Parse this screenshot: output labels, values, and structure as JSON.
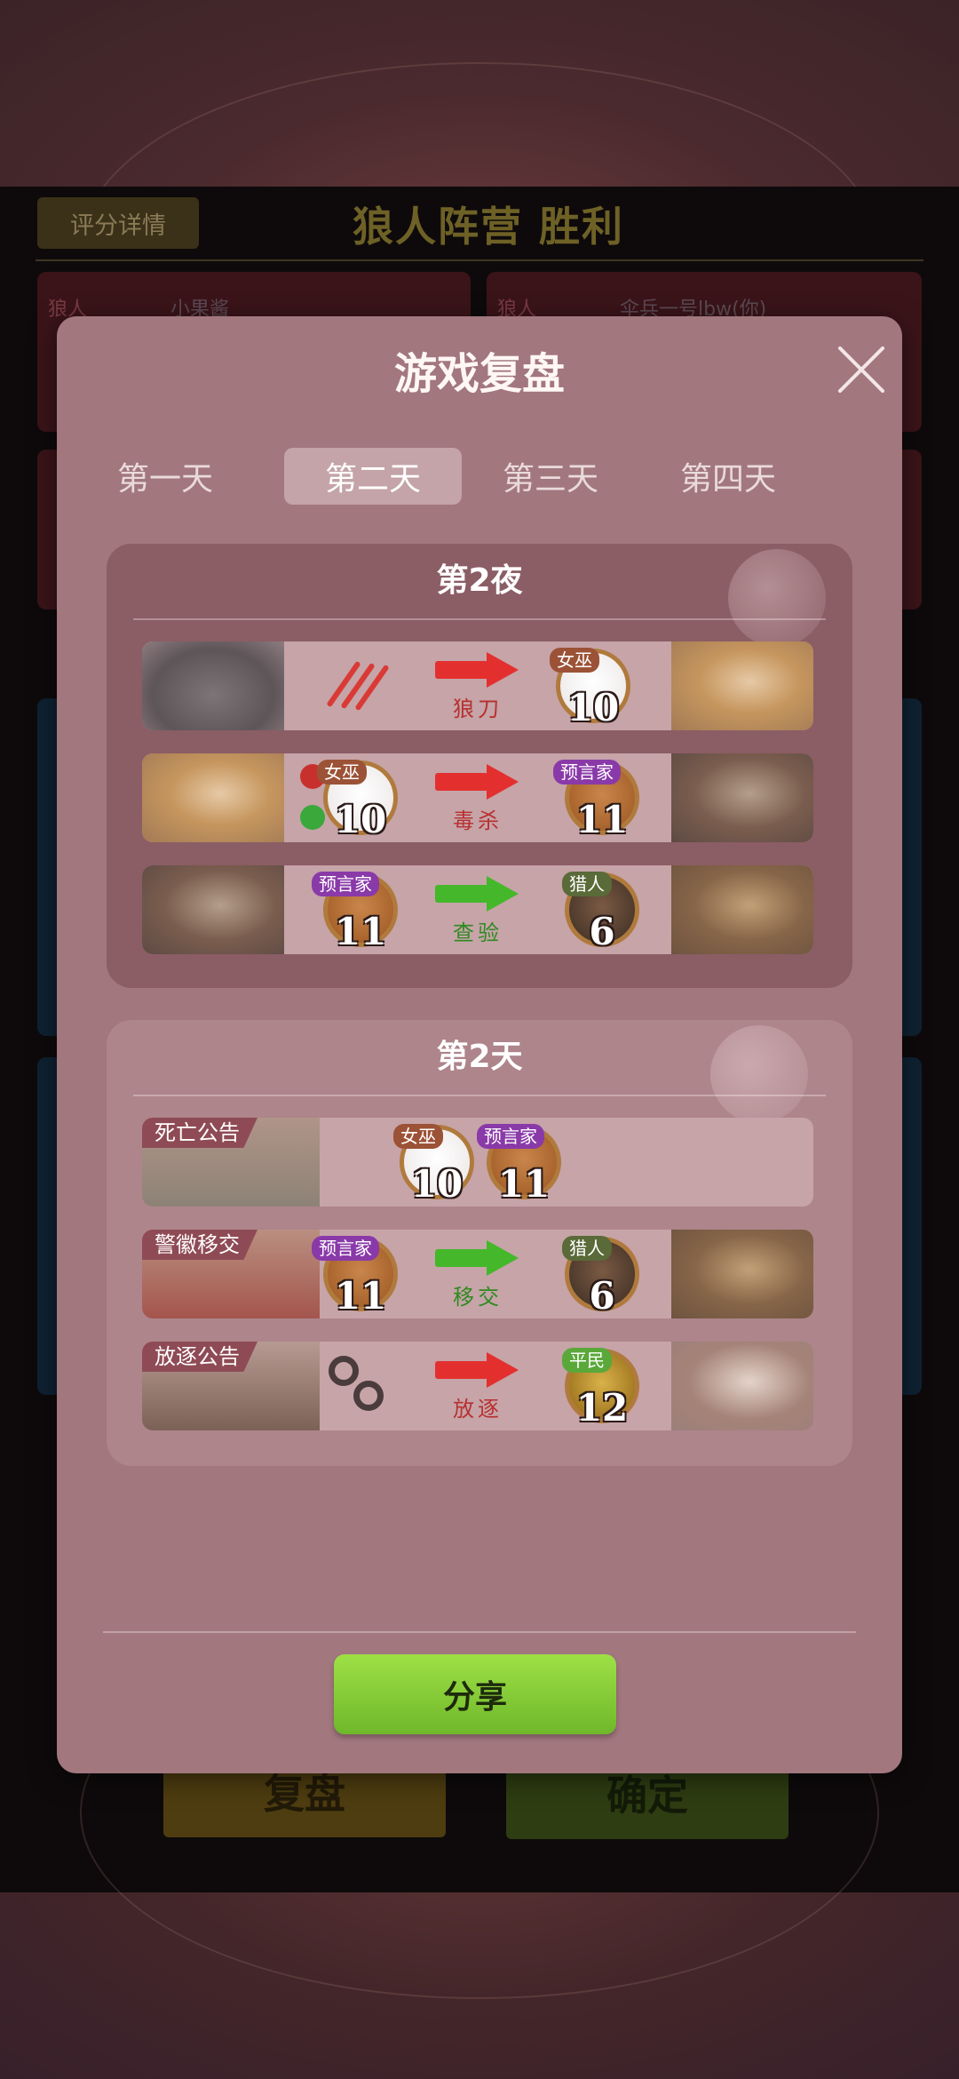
{
  "background": {
    "score_detail_label": "评分详情",
    "result_title": "狼人阵营  胜利",
    "cards": [
      {
        "label": "狼人",
        "name": "小果酱"
      },
      {
        "label": "狼人",
        "name": "伞兵一号lbw(你)"
      }
    ],
    "replay_button": "复盘",
    "confirm_button": "确定"
  },
  "modal": {
    "title": "游戏复盘",
    "tabs": [
      {
        "label": "第一天",
        "active": false
      },
      {
        "label": "第二天",
        "active": true
      },
      {
        "label": "第三天",
        "active": false
      },
      {
        "label": "第四天",
        "active": false
      }
    ],
    "night": {
      "title": "第2夜",
      "rows": [
        {
          "actor_role": "",
          "actor_number": "",
          "action": "狼刀",
          "color": "red",
          "target_role": "女巫",
          "target_number": "10"
        },
        {
          "actor_role": "女巫",
          "actor_number": "10",
          "action": "毒杀",
          "color": "red",
          "target_role": "预言家",
          "target_number": "11"
        },
        {
          "actor_role": "预言家",
          "actor_number": "11",
          "action": "查验",
          "color": "green",
          "target_role": "猎人",
          "target_number": "6"
        }
      ]
    },
    "day": {
      "title": "第2天",
      "rows": [
        {
          "event": "死亡公告",
          "players": [
            {
              "role": "女巫",
              "number": "10"
            },
            {
              "role": "预言家",
              "number": "11"
            }
          ]
        },
        {
          "event": "警徽移交",
          "actor_role": "预言家",
          "actor_number": "11",
          "action": "移交",
          "color": "green",
          "target_role": "猎人",
          "target_number": "6"
        },
        {
          "event": "放逐公告",
          "action": "放逐",
          "color": "red",
          "target_role": "平民",
          "target_number": "12"
        }
      ]
    },
    "share_button": "分享"
  },
  "colors": {
    "accent_red": "#e3302e",
    "accent_green": "#44b82a",
    "modal_bg": "#a2777e",
    "share_green": "#8ed43e"
  }
}
